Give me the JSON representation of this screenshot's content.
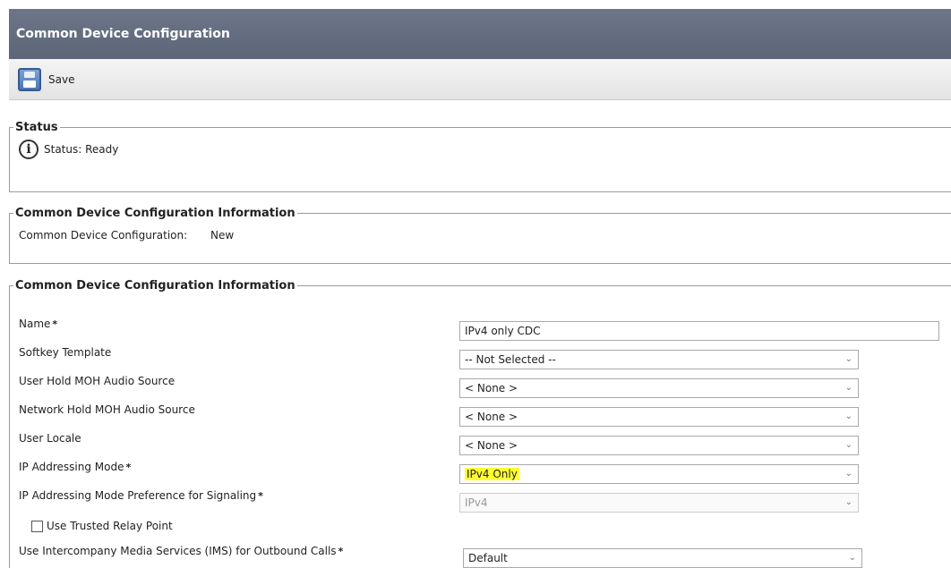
{
  "window": {
    "title": "Common Device Configuration"
  },
  "toolbar": {
    "save_label": "Save",
    "save_icon": "floppy-disk-icon"
  },
  "status": {
    "legend": "Status",
    "icon": "info-icon",
    "text": "Status: Ready"
  },
  "info1": {
    "legend": "Common Device Configuration Information",
    "label": "Common Device Configuration:",
    "value": "New"
  },
  "info2": {
    "legend": "Common Device Configuration Information",
    "fields": {
      "name": {
        "label": "Name",
        "value": "IPv4 only CDC",
        "required": "*"
      },
      "softkey": {
        "label": "Softkey Template",
        "value": "-- Not Selected --"
      },
      "user_hold": {
        "label": "User Hold MOH Audio Source",
        "value": "< None >"
      },
      "network_hold": {
        "label": "Network Hold MOH Audio Source",
        "value": "< None >"
      },
      "user_locale": {
        "label": "User Locale",
        "value": "< None >"
      },
      "ip_mode": {
        "label": "IP Addressing Mode",
        "value": "IPv4 Only",
        "required": "*",
        "highlight": "#ffff33"
      },
      "ip_pref": {
        "label": "IP Addressing Mode Preference for Signaling",
        "value": "IPv4",
        "required": "*",
        "disabled": true
      },
      "trusted_relay": {
        "label": "Use Trusted Relay Point",
        "checked": false
      },
      "ims": {
        "label": "Use Intercompany Media Services (IMS) for Outbound Calls",
        "value": "Default",
        "required": "*"
      }
    }
  }
}
